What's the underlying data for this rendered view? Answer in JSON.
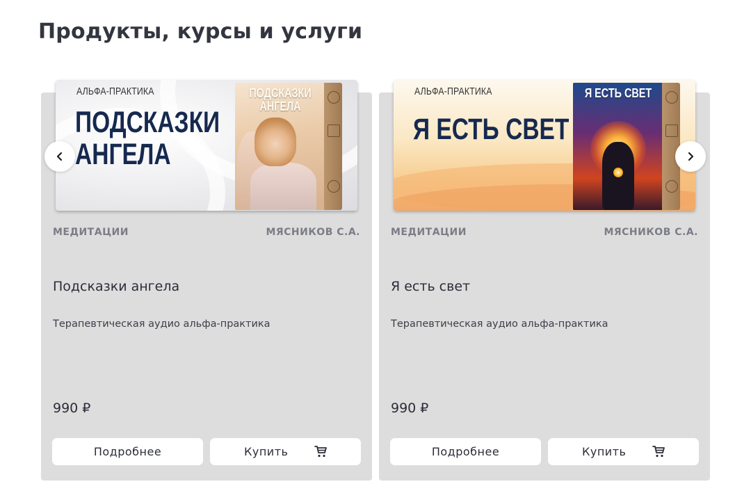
{
  "section": {
    "title": "Продукты, курсы и услуги"
  },
  "cards": [
    {
      "brand": "АЛЬФА-ПРАКТИКА",
      "headline": "ПОДСКАЗКИ АНГЕЛА",
      "box_title": "ПОДСКАЗКИ АНГЕЛА",
      "category": "МЕДИТАЦИИ",
      "author": "МЯСНИКОВ С.А.",
      "title": "Подсказки ангела",
      "description": "Терапевтическая аудио альфа-практика",
      "price": "990 ₽",
      "more_label": "Подробнее",
      "buy_label": "Купить"
    },
    {
      "brand": "АЛЬФА-ПРАКТИКА",
      "headline": "Я ЕСТЬ СВЕТ",
      "box_title": "Я ЕСТЬ СВЕТ",
      "category": "МЕДИТАЦИИ",
      "author": "МЯСНИКОВ С.А.",
      "title": "Я есть свет",
      "description": "Терапевтическая аудио альфа-практика",
      "price": "990 ₽",
      "more_label": "Подробнее",
      "buy_label": "Купить"
    }
  ],
  "icons": {
    "prev": "chevron-left-icon",
    "next": "chevron-right-icon",
    "cart": "cart-icon"
  },
  "colors": {
    "card_bg": "#dedddd",
    "headline": "#16294f",
    "meta_text": "#7b7d86",
    "button_bg": "#ffffff"
  }
}
